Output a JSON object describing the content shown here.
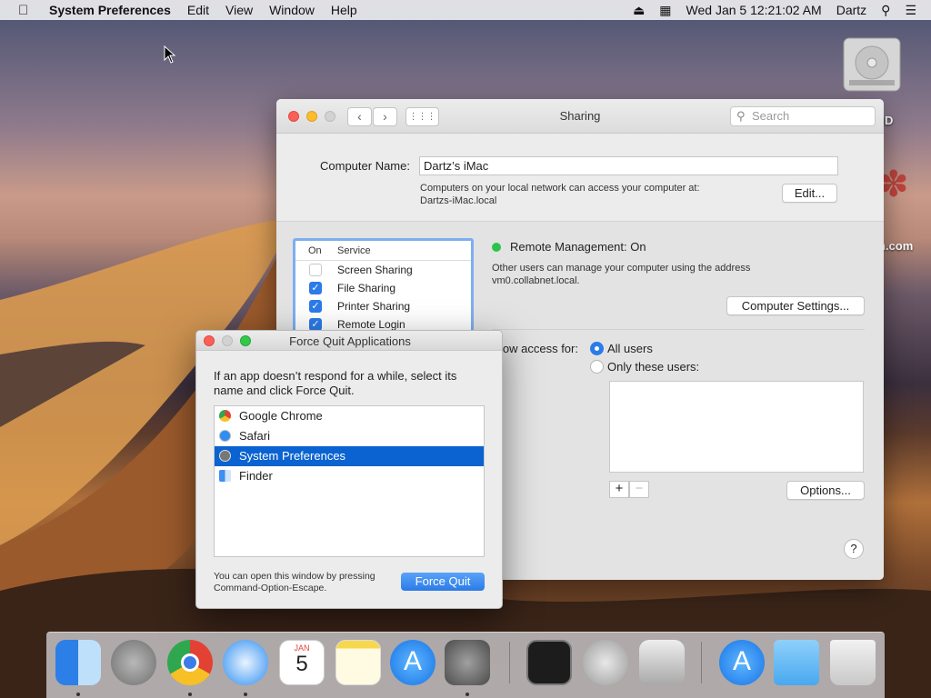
{
  "menubar": {
    "app_name": "System Preferences",
    "menus": [
      "Edit",
      "View",
      "Window",
      "Help"
    ],
    "datetime": "Wed Jan 5  12:21:02 AM",
    "user": "Dartz"
  },
  "desktop": {
    "hd_label": "h HD",
    "partial_label": "n.com"
  },
  "sharing": {
    "title": "Sharing",
    "search_placeholder": "Search",
    "computer_name_label": "Computer Name:",
    "computer_name_value": "Dartz’s iMac",
    "network_note_line1": "Computers on your local network can access your computer at:",
    "network_note_line2": "Dartzs-iMac.local",
    "edit_button": "Edit...",
    "services_header_on": "On",
    "services_header_service": "Service",
    "services": [
      {
        "name": "Screen Sharing",
        "checked": false
      },
      {
        "name": "File Sharing",
        "checked": true
      },
      {
        "name": "Printer Sharing",
        "checked": true
      },
      {
        "name": "Remote Login",
        "checked": true
      }
    ],
    "status": "Remote Management: On",
    "status_desc_line1": "Other users can manage your computer using the address",
    "status_desc_line2": "vm0.collabnet.local.",
    "computer_settings_button": "Computer Settings...",
    "allow_access_label": "low access for:",
    "radio_all": "All users",
    "radio_only": "Only these users:",
    "options_button": "Options...",
    "plus": "+",
    "minus": "−",
    "help": "?"
  },
  "force_quit": {
    "title": "Force Quit Applications",
    "description": "If an app doesn’t respond for a while, select its name and click Force Quit.",
    "apps": [
      {
        "name": "Google Chrome",
        "selected": false
      },
      {
        "name": "Safari",
        "selected": false
      },
      {
        "name": "System Preferences",
        "selected": true
      },
      {
        "name": "Finder",
        "selected": false
      }
    ],
    "note_line1": "You can open this window by pressing",
    "note_line2": "Command-Option-Escape.",
    "button": "Force Quit"
  },
  "dock": {
    "calendar_month": "JAN",
    "calendar_day": "5"
  }
}
